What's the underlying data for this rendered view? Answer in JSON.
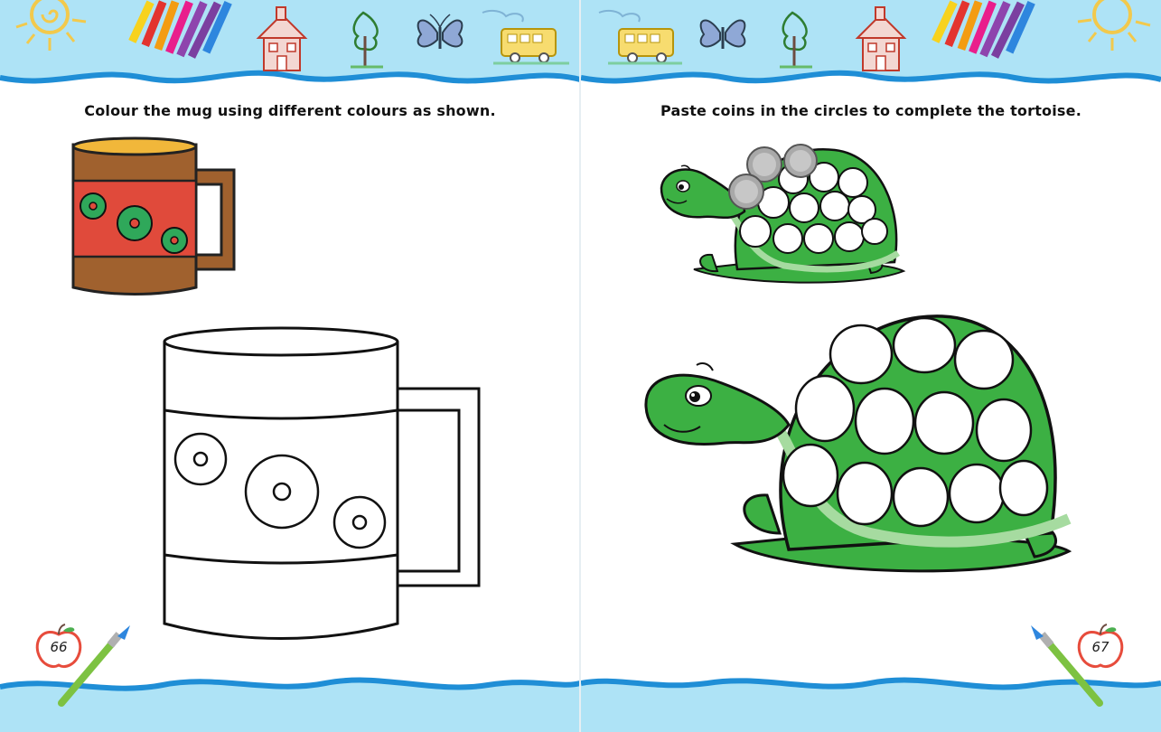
{
  "left_page": {
    "instruction": "Colour the mug using different colours as shown.",
    "page_number": "66"
  },
  "right_page": {
    "instruction": "Paste coins in the circles to complete the tortoise.",
    "page_number": "67"
  },
  "colors": {
    "sky": "#aee3f6",
    "wave": "#1f8ed6",
    "mug_brown": "#a0612e",
    "mug_red": "#e04a3b",
    "flower_green": "#2fa85a",
    "tortoise_green": "#3cb043",
    "tortoise_light": "#a6dba0",
    "coin_grey": "#a9a9a9"
  }
}
